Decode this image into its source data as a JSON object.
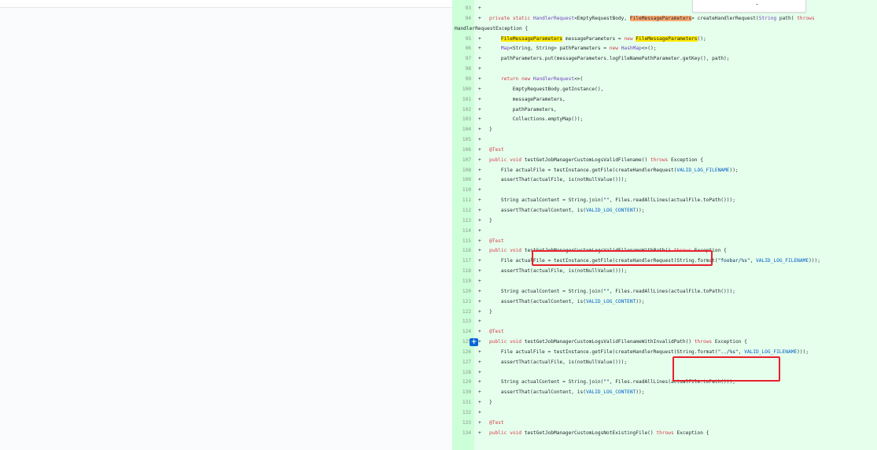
{
  "colors": {
    "diff_added_bg": "#e6ffed",
    "diff_gutter_bg": "#cdffd8",
    "annotation_red": "#e8202a",
    "match_highlight": "#ffea00",
    "current_match_highlight": "#ffab70",
    "expand_button": "#0366d6"
  },
  "popup": {
    "text": "-"
  },
  "expand_button_icon": "plus-icon",
  "expand_button_label": "+",
  "diff_lines": [
    {
      "num": "93",
      "sign": "+",
      "code": ""
    },
    {
      "num": "94",
      "sign": "+",
      "code": "private static HandlerRequest<EmptyRequestBody, FileMessageParameters> createHandlerRequest(String path) throws"
    },
    {
      "num": "",
      "sign": "",
      "code": "HandlerRequestException {"
    },
    {
      "num": "95",
      "sign": "+",
      "code": "    FileMessageParameters messageParameters = new FileMessageParameters();"
    },
    {
      "num": "96",
      "sign": "+",
      "code": "    Map<String, String> pathParameters = new HashMap<>();"
    },
    {
      "num": "97",
      "sign": "+",
      "code": "    pathParameters.put(messageParameters.logFileNamePathParameter.getKey(), path);"
    },
    {
      "num": "98",
      "sign": "+",
      "code": ""
    },
    {
      "num": "99",
      "sign": "+",
      "code": "    return new HandlerRequest<>("
    },
    {
      "num": "100",
      "sign": "+",
      "code": "        EmptyRequestBody.getInstance(),"
    },
    {
      "num": "101",
      "sign": "+",
      "code": "        messageParameters,"
    },
    {
      "num": "102",
      "sign": "+",
      "code": "        pathParameters,"
    },
    {
      "num": "103",
      "sign": "+",
      "code": "        Collections.emptyMap());"
    },
    {
      "num": "104",
      "sign": "+",
      "code": "}"
    },
    {
      "num": "105",
      "sign": "+",
      "code": ""
    },
    {
      "num": "106",
      "sign": "+",
      "code": "@Test"
    },
    {
      "num": "107",
      "sign": "+",
      "code": "public void testGetJobManagerCustomLogsValidFilename() throws Exception {"
    },
    {
      "num": "108",
      "sign": "+",
      "code": "    File actualFile = testInstance.getFile(createHandlerRequest(VALID_LOG_FILENAME));"
    },
    {
      "num": "109",
      "sign": "+",
      "code": "    assertThat(actualFile, is(notNullValue()));"
    },
    {
      "num": "110",
      "sign": "+",
      "code": ""
    },
    {
      "num": "111",
      "sign": "+",
      "code": "    String actualContent = String.join(\"\", Files.readAllLines(actualFile.toPath()));"
    },
    {
      "num": "112",
      "sign": "+",
      "code": "    assertThat(actualContent, is(VALID_LOG_CONTENT));"
    },
    {
      "num": "113",
      "sign": "+",
      "code": "}"
    },
    {
      "num": "114",
      "sign": "+",
      "code": ""
    },
    {
      "num": "115",
      "sign": "+",
      "code": "@Test"
    },
    {
      "num": "116",
      "sign": "+",
      "code": "public void testGetJobManagerCustomLogsValidFilenameWithPath() throws Exception {"
    },
    {
      "num": "117",
      "sign": "+",
      "code": "    File actualFile = testInstance.getFile(createHandlerRequest(String.format(\"foobar/%s\", VALID_LOG_FILENAME)));"
    },
    {
      "num": "118",
      "sign": "+",
      "code": "    assertThat(actualFile, is(notNullValue()));"
    },
    {
      "num": "119",
      "sign": "+",
      "code": ""
    },
    {
      "num": "120",
      "sign": "+",
      "code": "    String actualContent = String.join(\"\", Files.readAllLines(actualFile.toPath()));"
    },
    {
      "num": "121",
      "sign": "+",
      "code": "    assertThat(actualContent, is(VALID_LOG_CONTENT));"
    },
    {
      "num": "122",
      "sign": "+",
      "code": "}"
    },
    {
      "num": "123",
      "sign": "+",
      "code": ""
    },
    {
      "num": "124",
      "sign": "+",
      "code": "@Test"
    },
    {
      "num": "125",
      "sign": "+",
      "code": "public void testGetJobManagerCustomLogsValidFilenameWithInvalidPath() throws Exception {"
    },
    {
      "num": "126",
      "sign": "+",
      "code": "    File actualFile = testInstance.getFile(createHandlerRequest(String.format(\"../%s\", VALID_LOG_FILENAME)));"
    },
    {
      "num": "127",
      "sign": "+",
      "code": "    assertThat(actualFile, is(notNullValue()));"
    },
    {
      "num": "128",
      "sign": "+",
      "code": ""
    },
    {
      "num": "129",
      "sign": "+",
      "code": "    String actualContent = String.join(\"\", Files.readAllLines(actualFile.toPath()));"
    },
    {
      "num": "130",
      "sign": "+",
      "code": "    assertThat(actualContent, is(VALID_LOG_CONTENT));"
    },
    {
      "num": "131",
      "sign": "+",
      "code": "}"
    },
    {
      "num": "132",
      "sign": "+",
      "code": ""
    },
    {
      "num": "133",
      "sign": "+",
      "code": "@Test"
    },
    {
      "num": "134",
      "sign": "+",
      "code": "public void testGetJobManagerCustomLogsNotExistingFile() throws Exception {"
    }
  ]
}
